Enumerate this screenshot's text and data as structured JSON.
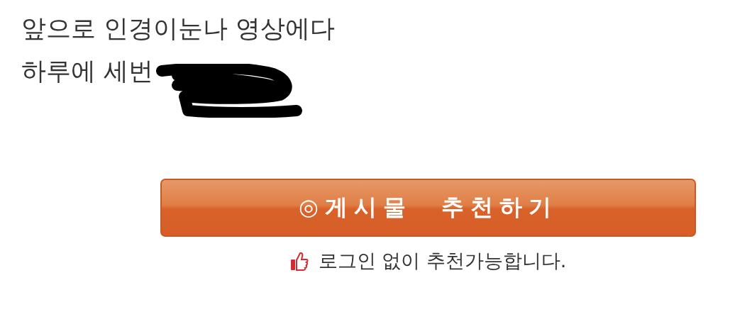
{
  "post": {
    "lines": [
      "앞으로 인경이눈나 영상에다",
      "하루에 세번"
    ],
    "redacted": true
  },
  "recommend_button": {
    "icon": "◎",
    "label": "게시물　추천하기"
  },
  "note": "로그인 없이 추천가능합니다."
}
